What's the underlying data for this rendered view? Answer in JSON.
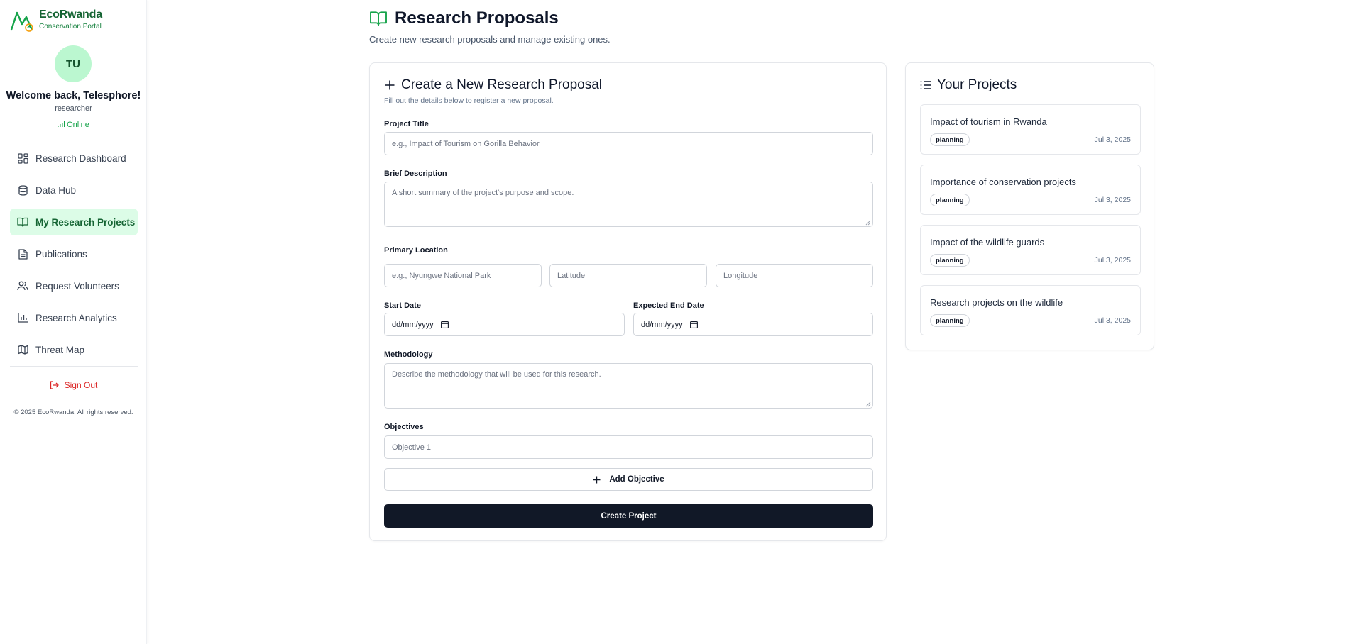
{
  "brand": {
    "name": "EcoRwanda",
    "subtitle": "Conservation Portal"
  },
  "user": {
    "initials": "TU",
    "welcome": "Welcome back, Telesphore!",
    "role": "researcher",
    "status": "Online"
  },
  "nav": {
    "items": [
      {
        "label": "Research Dashboard",
        "icon": "dashboard-icon",
        "active": false
      },
      {
        "label": "Data Hub",
        "icon": "database-icon",
        "active": false
      },
      {
        "label": "My Research Projects",
        "icon": "book-open-icon",
        "active": true
      },
      {
        "label": "Publications",
        "icon": "file-text-icon",
        "active": false
      },
      {
        "label": "Request Volunteers",
        "icon": "users-icon",
        "active": false
      },
      {
        "label": "Research Analytics",
        "icon": "bar-chart-icon",
        "active": false
      },
      {
        "label": "Threat Map",
        "icon": "map-icon",
        "active": false
      }
    ],
    "sign_out": "Sign Out",
    "copyright": "© 2025 EcoRwanda. All rights reserved."
  },
  "page": {
    "title": "Research Proposals",
    "subtitle": "Create new research proposals and manage existing ones."
  },
  "form": {
    "title": "Create a New Research Proposal",
    "description": "Fill out the details below to register a new proposal.",
    "project_title_label": "Project Title",
    "project_title_placeholder": "e.g., Impact of Tourism on Gorilla Behavior",
    "description_label": "Brief Description",
    "description_placeholder": "A short summary of the project's purpose and scope.",
    "location_label": "Primary Location",
    "location_placeholder": "e.g., Nyungwe National Park",
    "latitude_placeholder": "Latitude",
    "longitude_placeholder": "Longitude",
    "start_date_label": "Start Date",
    "start_date_value": "dd/mm/yyyy",
    "end_date_label": "Expected End Date",
    "end_date_value": "dd/mm/yyyy",
    "methodology_label": "Methodology",
    "methodology_placeholder": "Describe the methodology that will be used for this research.",
    "objectives_label": "Objectives",
    "objective_placeholder": "Objective 1",
    "add_objective": "Add Objective",
    "submit": "Create Project"
  },
  "projects": {
    "title": "Your Projects",
    "items": [
      {
        "title": "Impact of tourism in Rwanda",
        "status": "planning",
        "date": "Jul 3, 2025"
      },
      {
        "title": "Importance of conservation projects",
        "status": "planning",
        "date": "Jul 3, 2025"
      },
      {
        "title": "Impact of the wildlife guards",
        "status": "planning",
        "date": "Jul 3, 2025"
      },
      {
        "title": "Research projects on the wildlife",
        "status": "planning",
        "date": "Jul 3, 2025"
      }
    ]
  },
  "colors": {
    "brand_green": "#166534",
    "active_bg": "#dcfce7",
    "primary_button": "#111827",
    "danger": "#dc2626"
  }
}
